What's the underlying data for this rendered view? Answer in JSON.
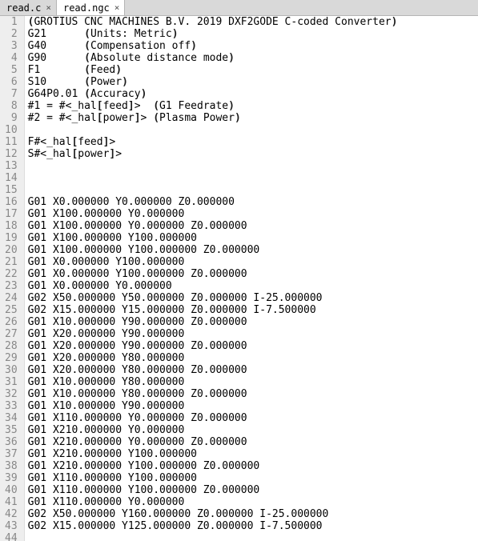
{
  "tabs": [
    {
      "label": "read.c",
      "active": false
    },
    {
      "label": "read.ngc",
      "active": true
    }
  ],
  "code": {
    "first_line": 1,
    "lines": [
      "(GROTIUS CNC MACHINES B.V. 2019 DXF2GODE C-coded Converter)",
      "G21      (Units: Metric)",
      "G40      (Compensation off)",
      "G90      (Absolute distance mode)",
      "F1       (Feed)",
      "S10      (Power)",
      "G64P0.01 (Accuracy)",
      "#1 = #<_hal[feed]>  (G1 Feedrate)",
      "#2 = #<_hal[power]> (Plasma Power)",
      "",
      "F#<_hal[feed]>",
      "S#<_hal[power]>",
      "",
      "",
      "",
      "G01 X0.000000 Y0.000000 Z0.000000",
      "G01 X100.000000 Y0.000000",
      "G01 X100.000000 Y0.000000 Z0.000000",
      "G01 X100.000000 Y100.000000",
      "G01 X100.000000 Y100.000000 Z0.000000",
      "G01 X0.000000 Y100.000000",
      "G01 X0.000000 Y100.000000 Z0.000000",
      "G01 X0.000000 Y0.000000",
      "G02 X50.000000 Y50.000000 Z0.000000 I-25.000000",
      "G02 X15.000000 Y15.000000 Z0.000000 I-7.500000",
      "G01 X10.000000 Y90.000000 Z0.000000",
      "G01 X20.000000 Y90.000000",
      "G01 X20.000000 Y90.000000 Z0.000000",
      "G01 X20.000000 Y80.000000",
      "G01 X20.000000 Y80.000000 Z0.000000",
      "G01 X10.000000 Y80.000000",
      "G01 X10.000000 Y80.000000 Z0.000000",
      "G01 X10.000000 Y90.000000",
      "G01 X110.000000 Y0.000000 Z0.000000",
      "G01 X210.000000 Y0.000000",
      "G01 X210.000000 Y0.000000 Z0.000000",
      "G01 X210.000000 Y100.000000",
      "G01 X210.000000 Y100.000000 Z0.000000",
      "G01 X110.000000 Y100.000000",
      "G01 X110.000000 Y100.000000 Z0.000000",
      "G01 X110.000000 Y0.000000",
      "G02 X50.000000 Y160.000000 Z0.000000 I-25.000000",
      "G02 X15.000000 Y125.000000 Z0.000000 I-7.500000"
    ]
  }
}
